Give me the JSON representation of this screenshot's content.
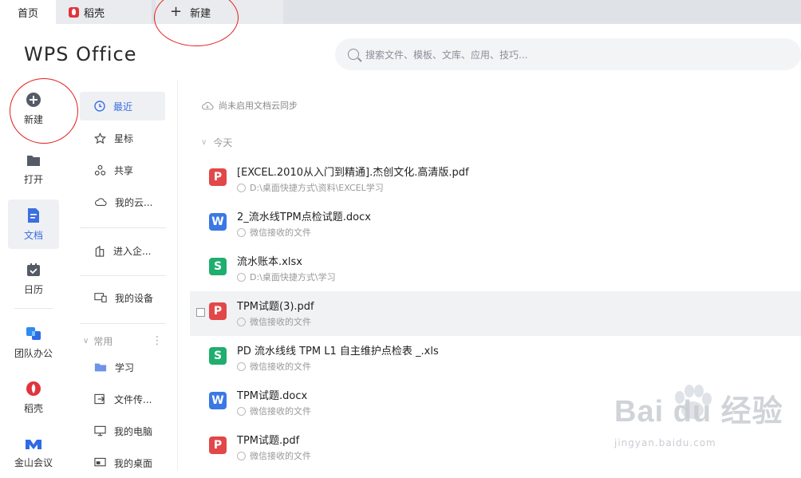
{
  "tabs": {
    "home": "首页",
    "daoke": "稻壳",
    "new_tab": "新建"
  },
  "header": {
    "logo": "WPS Office",
    "search_placeholder": "搜索文件、模板、文库、应用、技巧..."
  },
  "leftbar": {
    "items": [
      {
        "label": "新建",
        "icon": "plus-circle-icon"
      },
      {
        "label": "打开",
        "icon": "folder-icon"
      },
      {
        "label": "文档",
        "icon": "document-icon",
        "active": true
      },
      {
        "label": "日历",
        "icon": "calendar-icon"
      },
      {
        "label": "团队办公",
        "icon": "team-icon"
      },
      {
        "label": "稻壳",
        "icon": "daoke-icon"
      },
      {
        "label": "金山会议",
        "icon": "meeting-icon"
      }
    ]
  },
  "subnav": {
    "recent": "最近",
    "starred": "星标",
    "shared": "共享",
    "my_cloud": "我的云...",
    "enterprise": "进入企...",
    "my_devices": "我的设备",
    "common_header": "常用",
    "common": [
      "学习",
      "文件传...",
      "我的电脑",
      "我的桌面"
    ]
  },
  "main": {
    "sync_notice": "尚未启用文档云同步",
    "group_today": "今天",
    "files": [
      {
        "type": "pdf",
        "name": "[EXCEL.2010从入门到精通].杰创文化.高清版.pdf",
        "path": "D:\\桌面快捷方式\\资料\\EXCEL学习"
      },
      {
        "type": "word",
        "name": "2_流水线TPM点检试题.docx",
        "path": "微信接收的文件"
      },
      {
        "type": "sheet",
        "name": "流水账本.xlsx",
        "path": "D:\\桌面快捷方式\\学习"
      },
      {
        "type": "pdf",
        "name": "TPM试题(3).pdf",
        "path": "微信接收的文件",
        "hover": true
      },
      {
        "type": "sheet",
        "name": "PD  流水线线 TPM L1 自主维护点检表 _.xls",
        "path": "微信接收的文件"
      },
      {
        "type": "word",
        "name": "TPM试题.docx",
        "path": "微信接收的文件"
      },
      {
        "type": "pdf",
        "name": "TPM试题.pdf",
        "path": "微信接收的文件"
      }
    ]
  },
  "watermark": {
    "brand": "Bai du 经验",
    "url": "jingyan.baidu.com"
  },
  "colors": {
    "accent": "#3b6fe0",
    "pdf": "#e2474a",
    "word": "#3a78e6",
    "sheet": "#1fae6e",
    "annotation": "#e0201d"
  }
}
